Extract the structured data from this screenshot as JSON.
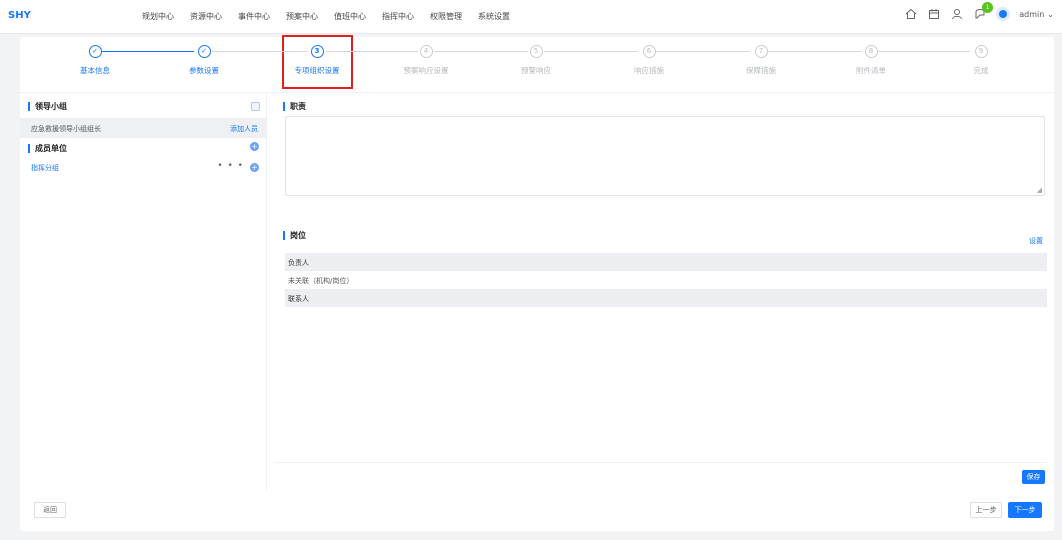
{
  "app": {
    "logo": "SHY"
  },
  "nav": [
    "规划中心",
    "资源中心",
    "事件中心",
    "预案中心",
    "值班中心",
    "指挥中心",
    "权限管理",
    "系统设置"
  ],
  "header": {
    "user_name": "admin",
    "notification_count": "1"
  },
  "steps": [
    {
      "number": "✓",
      "label": "基本信息",
      "state": "done"
    },
    {
      "number": "✓",
      "label": "参数设置",
      "state": "done"
    },
    {
      "number": "3",
      "label": "专项组织设置",
      "state": "active"
    },
    {
      "number": "4",
      "label": "预案响应设置",
      "state": "pending"
    },
    {
      "number": "5",
      "label": "预警响应",
      "state": "pending"
    },
    {
      "number": "6",
      "label": "响应措施",
      "state": "pending"
    },
    {
      "number": "7",
      "label": "保障措施",
      "state": "pending"
    },
    {
      "number": "8",
      "label": "附件清单",
      "state": "pending"
    },
    {
      "number": "9",
      "label": "完成",
      "state": "pending"
    }
  ],
  "left_panel": {
    "leader_group_title": "领导小组",
    "leader_name": "应急救援领导小组组长",
    "leader_action": "添加人员",
    "member_unit_title": "成员单位",
    "member_name": "指挥分组"
  },
  "right_panel": {
    "duty_title": "职责",
    "duty_value": "",
    "post_title": "岗位",
    "settings_label": "设置",
    "post_rows": [
      {
        "text": "负责人",
        "style": "shade"
      },
      {
        "text": "未关联（机构/岗位）",
        "style": "plain"
      },
      {
        "text": "联系人",
        "style": "shade"
      }
    ],
    "save_label": "保存"
  },
  "footer": {
    "return_label": "返回",
    "prev_label": "上一步",
    "next_label": "下一步"
  }
}
